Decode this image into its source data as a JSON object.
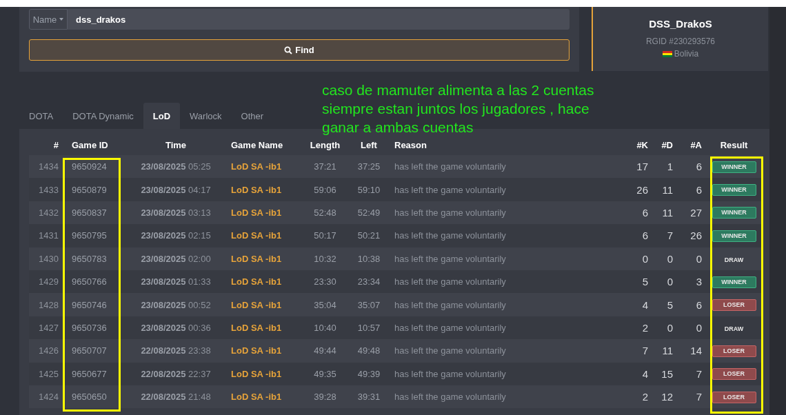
{
  "search": {
    "filter_label": "Name",
    "value": "dss_drakos",
    "button": "Find"
  },
  "profile": {
    "name": "DSS_DrakoS",
    "rgid": "RGID #230293576",
    "country": "Bolivia"
  },
  "annotation": {
    "lines": [
      "caso de mamuter alimenta a las 2 cuentas",
      "siempre estan juntos los jugadores , hace",
      "ganar a ambas cuentas"
    ]
  },
  "tabs": [
    {
      "label": "DOTA",
      "selected": false
    },
    {
      "label": "DOTA Dynamic",
      "selected": false
    },
    {
      "label": "LoD",
      "selected": true
    },
    {
      "label": "Warlock",
      "selected": false
    },
    {
      "label": "Other",
      "selected": false
    }
  ],
  "table": {
    "columns": [
      {
        "label": "#",
        "highlighted": false
      },
      {
        "label": "Game ID",
        "highlighted": true
      },
      {
        "label": "Time",
        "highlighted": false
      },
      {
        "label": "Game Name",
        "highlighted": false
      },
      {
        "label": "Length",
        "highlighted": false
      },
      {
        "label": "Left",
        "highlighted": false
      },
      {
        "label": "Reason",
        "highlighted": false
      },
      {
        "label": "#K",
        "highlighted": false
      },
      {
        "label": "#D",
        "highlighted": false
      },
      {
        "label": "#A",
        "highlighted": false
      },
      {
        "label": "Result",
        "highlighted": true
      }
    ],
    "rows": [
      {
        "num": "1434",
        "game_id": "9650924",
        "date": "23/08/2025",
        "time": "05:25",
        "game_name": "LoD SA -ib1",
        "length": "37:21",
        "left": "37:25",
        "reason": "has left the game voluntarily",
        "k": "17",
        "d": "1",
        "a": "6",
        "result": "WINNER",
        "kind": "winner"
      },
      {
        "num": "1433",
        "game_id": "9650879",
        "date": "23/08/2025",
        "time": "04:17",
        "game_name": "LoD SA -ib1",
        "length": "59:06",
        "left": "59:10",
        "reason": "has left the game voluntarily",
        "k": "26",
        "d": "11",
        "a": "6",
        "result": "WINNER",
        "kind": "winner"
      },
      {
        "num": "1432",
        "game_id": "9650837",
        "date": "23/08/2025",
        "time": "03:13",
        "game_name": "LoD SA -ib1",
        "length": "52:48",
        "left": "52:49",
        "reason": "has left the game voluntarily",
        "k": "6",
        "d": "11",
        "a": "27",
        "result": "WINNER",
        "kind": "winner"
      },
      {
        "num": "1431",
        "game_id": "9650795",
        "date": "23/08/2025",
        "time": "02:15",
        "game_name": "LoD SA -ib1",
        "length": "50:17",
        "left": "50:21",
        "reason": "has left the game voluntarily",
        "k": "6",
        "d": "7",
        "a": "26",
        "result": "WINNER",
        "kind": "winner"
      },
      {
        "num": "1430",
        "game_id": "9650783",
        "date": "23/08/2025",
        "time": "02:00",
        "game_name": "LoD SA -ib1",
        "length": "10:32",
        "left": "10:38",
        "reason": "has left the game voluntarily",
        "k": "0",
        "d": "0",
        "a": "0",
        "result": "DRAW",
        "kind": "draw"
      },
      {
        "num": "1429",
        "game_id": "9650766",
        "date": "23/08/2025",
        "time": "01:33",
        "game_name": "LoD SA -ib1",
        "length": "23:30",
        "left": "23:34",
        "reason": "has left the game voluntarily",
        "k": "5",
        "d": "0",
        "a": "3",
        "result": "WINNER",
        "kind": "winner"
      },
      {
        "num": "1428",
        "game_id": "9650746",
        "date": "23/08/2025",
        "time": "00:52",
        "game_name": "LoD SA -ib1",
        "length": "35:04",
        "left": "35:07",
        "reason": "has left the game voluntarily",
        "k": "4",
        "d": "5",
        "a": "6",
        "result": "LOSER",
        "kind": "loser"
      },
      {
        "num": "1427",
        "game_id": "9650736",
        "date": "23/08/2025",
        "time": "00:36",
        "game_name": "LoD SA -ib1",
        "length": "10:40",
        "left": "10:57",
        "reason": "has left the game voluntarily",
        "k": "2",
        "d": "0",
        "a": "0",
        "result": "DRAW",
        "kind": "draw"
      },
      {
        "num": "1426",
        "game_id": "9650707",
        "date": "22/08/2025",
        "time": "23:38",
        "game_name": "LoD SA -ib1",
        "length": "49:44",
        "left": "49:48",
        "reason": "has left the game voluntarily",
        "k": "7",
        "d": "11",
        "a": "14",
        "result": "LOSER",
        "kind": "loser"
      },
      {
        "num": "1425",
        "game_id": "9650677",
        "date": "22/08/2025",
        "time": "22:37",
        "game_name": "LoD SA -ib1",
        "length": "49:35",
        "left": "49:39",
        "reason": "has left the game voluntarily",
        "k": "4",
        "d": "15",
        "a": "7",
        "result": "LOSER",
        "kind": "loser"
      },
      {
        "num": "1424",
        "game_id": "9650650",
        "date": "22/08/2025",
        "time": "21:48",
        "game_name": "LoD SA -ib1",
        "length": "39:28",
        "left": "39:31",
        "reason": "has left the game voluntarily",
        "k": "2",
        "d": "12",
        "a": "7",
        "result": "LOSER",
        "kind": "loser"
      }
    ]
  }
}
